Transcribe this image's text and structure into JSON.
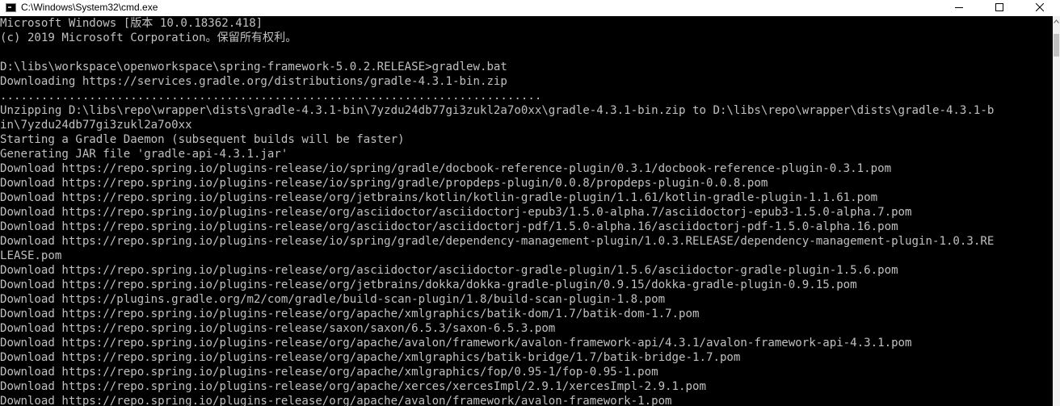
{
  "window": {
    "title": "C:\\Windows\\System32\\cmd.exe"
  },
  "console": {
    "lines": [
      "Microsoft Windows [版本 10.0.18362.418]",
      "(c) 2019 Microsoft Corporation。保留所有权利。",
      "",
      "D:\\libs\\workspace\\openworkspace\\spring-framework-5.0.2.RELEASE>gradlew.bat",
      "Downloading https://services.gradle.org/distributions/gradle-4.3.1-bin.zip",
      "...............................................................................",
      "Unzipping D:\\libs\\repo\\wrapper\\dists\\gradle-4.3.1-bin\\7yzdu24db77gi3zukl2a7o0xx\\gradle-4.3.1-bin.zip to D:\\libs\\repo\\wrapper\\dists\\gradle-4.3.1-b",
      "in\\7yzdu24db77gi3zukl2a7o0xx",
      "Starting a Gradle Daemon (subsequent builds will be faster)",
      "Generating JAR file 'gradle-api-4.3.1.jar'",
      "Download https://repo.spring.io/plugins-release/io/spring/gradle/docbook-reference-plugin/0.3.1/docbook-reference-plugin-0.3.1.pom",
      "Download https://repo.spring.io/plugins-release/io/spring/gradle/propdeps-plugin/0.0.8/propdeps-plugin-0.0.8.pom",
      "Download https://repo.spring.io/plugins-release/org/jetbrains/kotlin/kotlin-gradle-plugin/1.1.61/kotlin-gradle-plugin-1.1.61.pom",
      "Download https://repo.spring.io/plugins-release/org/asciidoctor/asciidoctorj-epub3/1.5.0-alpha.7/asciidoctorj-epub3-1.5.0-alpha.7.pom",
      "Download https://repo.spring.io/plugins-release/org/asciidoctor/asciidoctorj-pdf/1.5.0-alpha.16/asciidoctorj-pdf-1.5.0-alpha.16.pom",
      "Download https://repo.spring.io/plugins-release/io/spring/gradle/dependency-management-plugin/1.0.3.RELEASE/dependency-management-plugin-1.0.3.RE",
      "LEASE.pom",
      "Download https://repo.spring.io/plugins-release/org/asciidoctor/asciidoctor-gradle-plugin/1.5.6/asciidoctor-gradle-plugin-1.5.6.pom",
      "Download https://repo.spring.io/plugins-release/org/jetbrains/dokka/dokka-gradle-plugin/0.9.15/dokka-gradle-plugin-0.9.15.pom",
      "Download https://plugins.gradle.org/m2/com/gradle/build-scan-plugin/1.8/build-scan-plugin-1.8.pom",
      "Download https://repo.spring.io/plugins-release/org/apache/xmlgraphics/batik-dom/1.7/batik-dom-1.7.pom",
      "Download https://repo.spring.io/plugins-release/saxon/saxon/6.5.3/saxon-6.5.3.pom",
      "Download https://repo.spring.io/plugins-release/org/apache/avalon/framework/avalon-framework-api/4.3.1/avalon-framework-api-4.3.1.pom",
      "Download https://repo.spring.io/plugins-release/org/apache/xmlgraphics/batik-bridge/1.7/batik-bridge-1.7.pom",
      "Download https://repo.spring.io/plugins-release/org/apache/xmlgraphics/fop/0.95-1/fop-0.95-1.pom",
      "Download https://repo.spring.io/plugins-release/org/apache/xerces/xercesImpl/2.9.1/xercesImpl-2.9.1.pom",
      "Download https://repo.spring.io/plugins-release/org/apache/avalon/framework/avalon-framework-1.pom"
    ]
  },
  "icons": {
    "app": "cmd-icon",
    "minimize": "minimize-icon",
    "maximize": "maximize-icon",
    "close": "close-icon",
    "scroll_up": "chevron-up-icon"
  },
  "colors": {
    "console_background": "#000000",
    "console_text": "#c0c0c0",
    "titlebar_background": "#ffffff"
  }
}
